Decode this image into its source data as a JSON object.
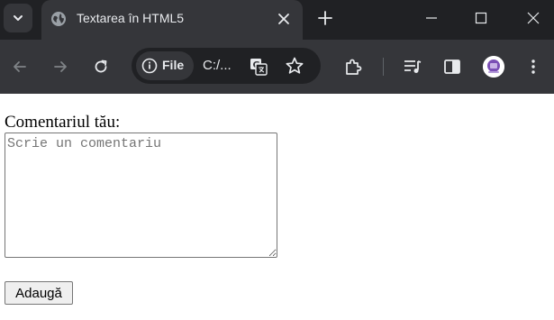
{
  "browser": {
    "tab": {
      "title": "Textarea în HTML5"
    },
    "address_bar": {
      "site_chip_label": "File",
      "url": "C:/..."
    },
    "icons": {
      "tab_menu": "chevron-down-icon",
      "favicon": "globe-icon",
      "tab_close": "close-icon",
      "new_tab": "plus-icon",
      "back": "arrow-left-icon",
      "forward": "arrow-right-icon",
      "reload": "reload-icon",
      "info": "info-icon",
      "translate": "translate-icon",
      "bookmark": "star-icon",
      "extensions": "puzzle-icon",
      "media": "media-queue-icon",
      "side_panel": "side-panel-icon",
      "menu": "kebab-menu-icon"
    },
    "colors": {
      "tabstrip_bg": "#202124",
      "toolbar_bg": "#35363a",
      "text": "#e8eaed"
    }
  },
  "page": {
    "label": "Comentariul tău:",
    "textarea": {
      "placeholder": "Scrie un comentariu",
      "value": ""
    },
    "submit_button": "Adaugă"
  }
}
